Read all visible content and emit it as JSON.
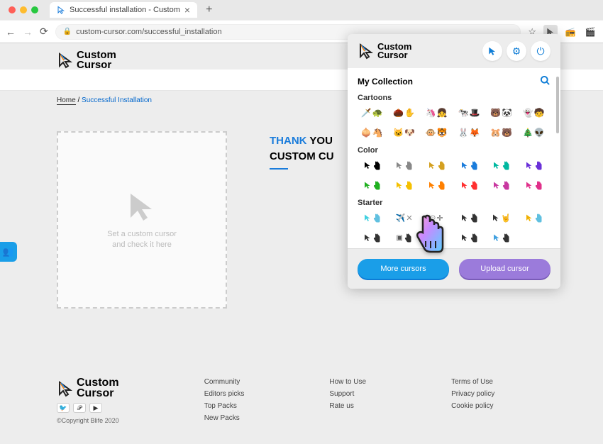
{
  "browser": {
    "tab_title": "Successful installation - Custom",
    "url": "custom-cursor.com/successful_installation"
  },
  "page": {
    "logo_line1": "Custom",
    "logo_line2": "Cursor",
    "breadcrumb_home": "Home",
    "breadcrumb_sep": "/",
    "breadcrumb_current": "Successful Installation",
    "thank_word": "THANK",
    "thank_rest": "YOU",
    "custom_line": "CUSTOM CU",
    "cursor_box_line1": "Set a custom cursor",
    "cursor_box_line2": "and check it here"
  },
  "popup": {
    "collection_title": "My Collection",
    "categories": {
      "cartoons": "Cartoons",
      "color": "Color",
      "starter": "Starter"
    },
    "cartoons_items": [
      [
        "🗡️",
        "🐢"
      ],
      [
        "🌰",
        "✋"
      ],
      [
        "🦄",
        "👧"
      ],
      [
        "🐄",
        "🎩"
      ],
      [
        "🐻",
        "🐼"
      ],
      [
        "👻",
        "🧒"
      ],
      [
        "🧅",
        "🐴"
      ],
      [
        "🐱",
        "🐶"
      ],
      [
        "🐵",
        "🐯"
      ],
      [
        "🐰",
        "🦊"
      ],
      [
        "🐹",
        "🐻"
      ],
      [
        "🎄",
        "👽"
      ]
    ],
    "color_items": [
      [
        "#000000",
        "#000000"
      ],
      [
        "#888888",
        "#888888"
      ],
      [
        "#d4a020",
        "#d4a020"
      ],
      [
        "#1a7cdb",
        "#1a7cdb"
      ],
      [
        "#00b8a0",
        "#00b8a0"
      ],
      [
        "#6a30d8",
        "#6a30d8"
      ],
      [
        "#20b020",
        "#20b020"
      ],
      [
        "#f5c000",
        "#f5c000"
      ],
      [
        "#ff8000",
        "#ff8000"
      ],
      [
        "#ff3030",
        "#ff3030"
      ],
      [
        "#c838a0",
        "#c838a0"
      ],
      [
        "#e0308a",
        "#e0308a"
      ]
    ],
    "starter_items": [
      [
        "aqua",
        "hand"
      ],
      [
        "plane",
        "cross"
      ],
      [
        "dot",
        "target"
      ],
      [
        "arrow",
        "point"
      ],
      [
        "arrow",
        "rock"
      ],
      [
        "gold",
        "hand"
      ],
      [
        "arrow",
        "point"
      ],
      [
        "pixel",
        "point"
      ],
      [
        "multi",
        "star"
      ],
      [
        "arrow",
        "point"
      ],
      [
        "wave",
        "point"
      ]
    ],
    "more_btn": "More cursors",
    "upload_btn": "Upload cursor"
  },
  "footer": {
    "copyright": "©Copyright Blife 2020",
    "col1": [
      "Community",
      "Editors picks",
      "Top Packs",
      "New Packs"
    ],
    "col2": [
      "How to Use",
      "Support",
      "Rate us"
    ],
    "col3": [
      "Terms of Use",
      "Privacy policy",
      "Cookie policy"
    ]
  }
}
